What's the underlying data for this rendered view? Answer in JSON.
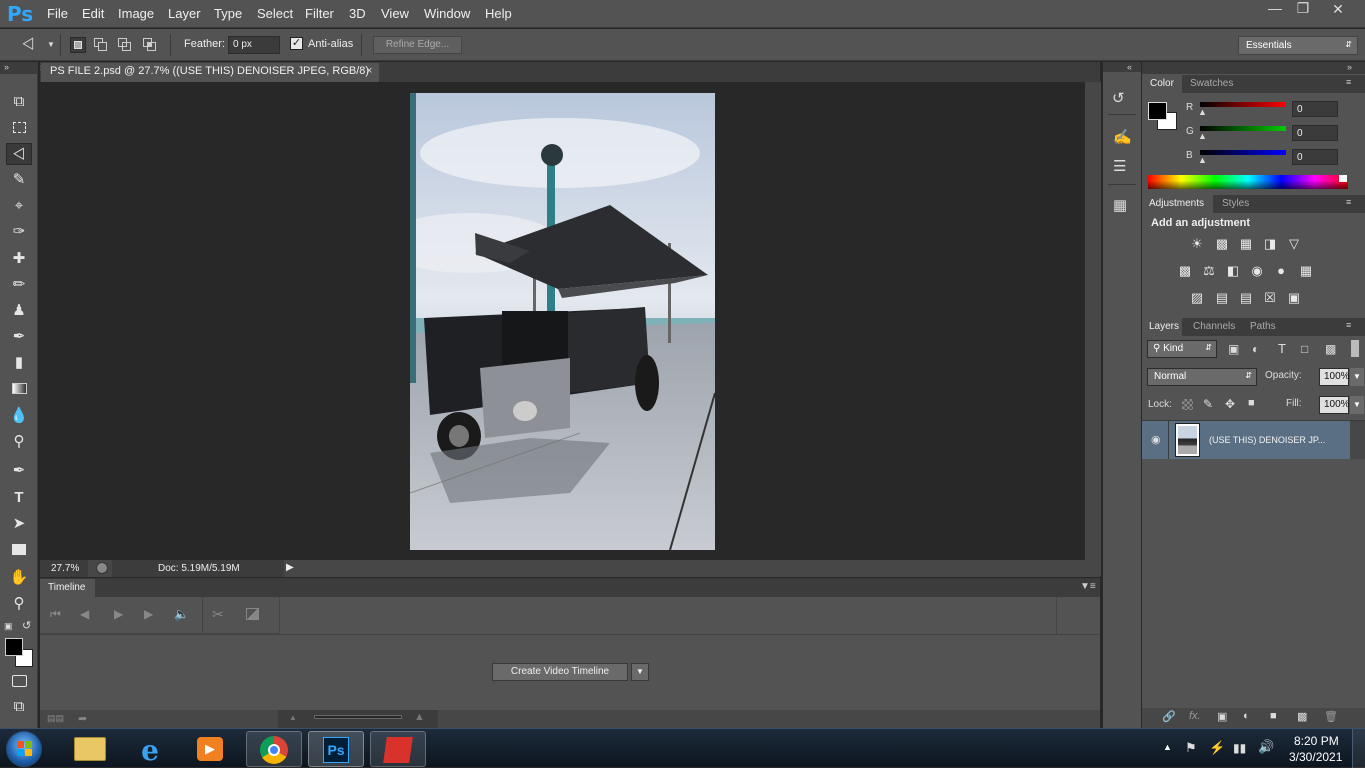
{
  "app": {
    "logo": "Ps"
  },
  "menu": [
    "File",
    "Edit",
    "Image",
    "Layer",
    "Type",
    "Select",
    "Filter",
    "3D",
    "View",
    "Window",
    "Help"
  ],
  "window_controls": {
    "minimize": "—",
    "restore": "❐",
    "close": "✕"
  },
  "options": {
    "feather_label": "Feather:",
    "feather_value": "0 px",
    "antialias_label": "Anti-alias",
    "antialias_checked": true,
    "refine_edge": "Refine Edge...",
    "workspace": "Essentials"
  },
  "document": {
    "tab_title": "PS FILE 2.psd @ 27.7% ((USE THIS) DENOISER JPEG, RGB/8)",
    "close": "×"
  },
  "status": {
    "zoom": "27.7%",
    "doc": "Doc: 5.19M/5.19M"
  },
  "timeline": {
    "title": "Timeline",
    "create_button": "Create Video Timeline"
  },
  "color_panel": {
    "tabs": [
      "Color",
      "Swatches"
    ],
    "channels": [
      {
        "label": "R",
        "value": "0"
      },
      {
        "label": "G",
        "value": "0"
      },
      {
        "label": "B",
        "value": "0"
      }
    ]
  },
  "adjustments_panel": {
    "tabs": [
      "Adjustments",
      "Styles"
    ],
    "heading": "Add an adjustment"
  },
  "layers_panel": {
    "tabs": [
      "Layers",
      "Channels",
      "Paths"
    ],
    "filter_kind": "Kind",
    "blend_mode": "Normal",
    "opacity_label": "Opacity:",
    "opacity_value": "100%",
    "lock_label": "Lock:",
    "fill_label": "Fill:",
    "fill_value": "100%",
    "layers": [
      {
        "name": "(USE THIS) DENOISER JP...",
        "visible": true,
        "selected": true
      }
    ]
  },
  "taskbar": {
    "time": "8:20 PM",
    "date": "3/30/2021"
  },
  "colors": {
    "accent": "#31a8ff",
    "panel": "#535353",
    "canvas_bg": "#282828",
    "selected_layer": "#5a6e84"
  }
}
